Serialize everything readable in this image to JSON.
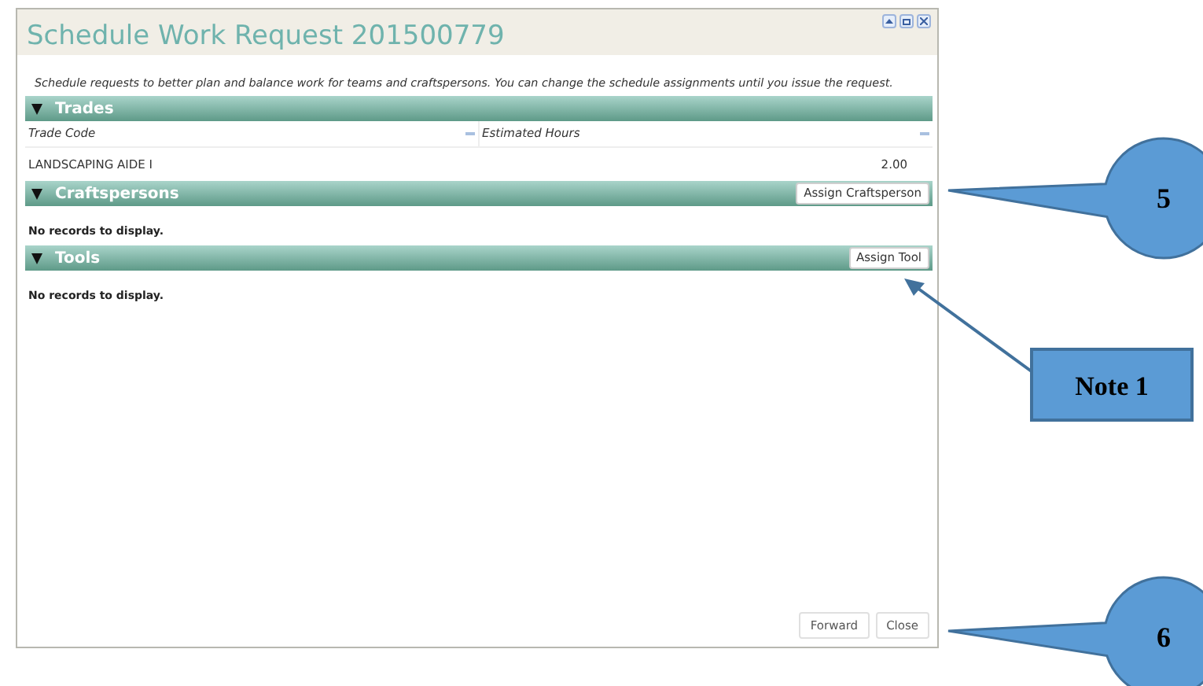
{
  "window": {
    "title": "Schedule Work Request 201500779",
    "controls": [
      {
        "kind": "collapse"
      },
      {
        "kind": "maximize"
      },
      {
        "kind": "close"
      }
    ]
  },
  "description": "Schedule requests to better plan and balance work for teams and craftspersons. You can change the schedule assignments until you issue the request.",
  "sections": [
    {
      "title": "Trades",
      "expanded": true,
      "columns": [
        "Trade Code",
        "Estimated Hours"
      ],
      "rows": [
        [
          "LANDSCAPING AIDE I",
          "2.00"
        ]
      ]
    },
    {
      "title": "Craftspersons",
      "expanded": true,
      "action": "Assign Craftsperson",
      "empty_message": "No records to display."
    },
    {
      "title": "Tools",
      "expanded": true,
      "action": "Assign Tool",
      "empty_message": "No records to display."
    }
  ],
  "footer_buttons": [
    "Forward",
    "Close"
  ],
  "annotations": [
    {
      "kind": "bubble",
      "label": "5"
    },
    {
      "kind": "box",
      "label": "Note 1"
    },
    {
      "kind": "bubble",
      "label": "6"
    }
  ]
}
